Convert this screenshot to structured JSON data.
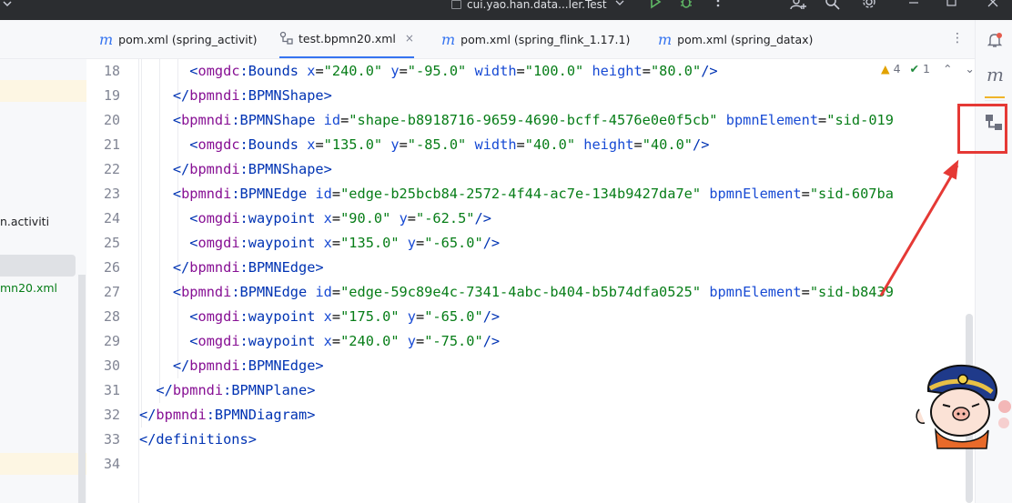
{
  "titlebar": {
    "project_name": "cui.yao.han.data...ler.Test"
  },
  "project_panel": {
    "items": [
      {
        "label": "n.activiti"
      },
      {
        "label": "mn20.xml"
      }
    ]
  },
  "tabs": [
    {
      "label": "pom.xml (spring_activit)",
      "icon": "maven-icon",
      "active": false
    },
    {
      "label": "test.bpmn20.xml",
      "icon": "bpmn-icon",
      "active": true
    },
    {
      "label": "pom.xml (spring_flink_1.17.1)",
      "icon": "maven-icon",
      "active": false
    },
    {
      "label": "pom.xml (spring_datax)",
      "icon": "maven-icon",
      "active": false
    }
  ],
  "tab_close_glyph": "×",
  "tab_more_glyph": "⋮",
  "inspections": {
    "warnings": "4",
    "ok": "1"
  },
  "editor": {
    "line_numbers": [
      "18",
      "19",
      "20",
      "21",
      "22",
      "23",
      "24",
      "25",
      "26",
      "27",
      "28",
      "29",
      "30",
      "31",
      "32",
      "33",
      "34"
    ],
    "lines": [
      "      <omgdc:Bounds x=\"240.0\" y=\"-95.0\" width=\"100.0\" height=\"80.0\"/>",
      "    </bpmndi:BPMNShape>",
      "    <bpmndi:BPMNShape id=\"shape-b8918716-9659-4690-bcff-4576e0e0f5cb\" bpmnElement=\"sid-019",
      "      <omgdc:Bounds x=\"135.0\" y=\"-85.0\" width=\"40.0\" height=\"40.0\"/>",
      "    </bpmndi:BPMNShape>",
      "    <bpmndi:BPMNEdge id=\"edge-b25bcb84-2572-4f44-ac7e-134b9427da7e\" bpmnElement=\"sid-607ba",
      "      <omgdi:waypoint x=\"90.0\" y=\"-62.5\"/>",
      "      <omgdi:waypoint x=\"135.0\" y=\"-65.0\"/>",
      "    </bpmndi:BPMNEdge>",
      "    <bpmndi:BPMNEdge id=\"edge-59c89e4c-7341-4abc-b404-b5b74dfa0525\" bpmnElement=\"sid-b8439",
      "      <omgdi:waypoint x=\"175.0\" y=\"-65.0\"/>",
      "      <omgdi:waypoint x=\"240.0\" y=\"-75.0\"/>",
      "    </bpmndi:BPMNEdge>",
      "  </bpmndi:BPMNPlane>",
      "</bpmndi:BPMNDiagram>",
      "</definitions>",
      ""
    ]
  },
  "right_strip": {
    "icons": [
      "notifications-icon",
      "maven-icon",
      "bpmn-designer-icon"
    ],
    "maven_letter": "m"
  },
  "annotation": {
    "highlight_color": "#e53935",
    "points_to": "bpmn-designer-icon"
  }
}
